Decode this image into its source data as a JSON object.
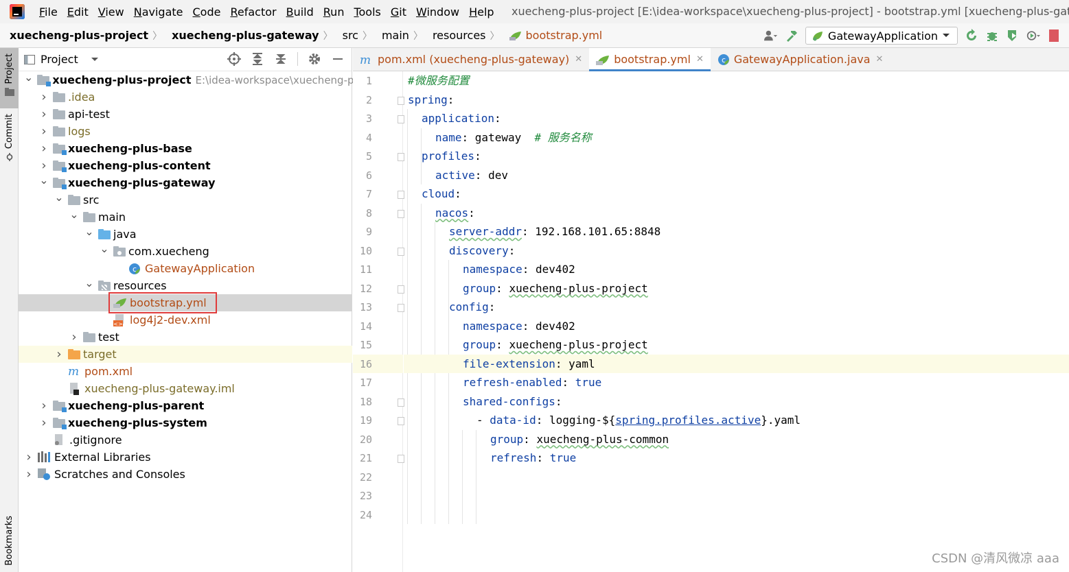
{
  "menubar": {
    "items": [
      "File",
      "Edit",
      "View",
      "Navigate",
      "Code",
      "Refactor",
      "Build",
      "Run",
      "Tools",
      "Git",
      "Window",
      "Help"
    ],
    "window_title": "xuecheng-plus-project [E:\\idea-workspace\\xuecheng-plus-project] - bootstrap.yml [xuecheng-plus-gateway]"
  },
  "breadcrumb": {
    "items": [
      "xuecheng-plus-project",
      "xuecheng-plus-gateway",
      "src",
      "main",
      "resources",
      "bootstrap.yml"
    ]
  },
  "toolbar": {
    "run_config": "GatewayApplication",
    "icons": [
      "user-icon",
      "build-hammer-icon",
      "rerun-icon",
      "debug-icon",
      "coverage-icon",
      "profile-icon",
      "more-icon",
      "stop-icon"
    ]
  },
  "left_stripe": {
    "tabs": [
      "Project",
      "Commit",
      "Bookmarks"
    ]
  },
  "project_panel": {
    "title": "Project",
    "tree": [
      {
        "label": "xuecheng-plus-project",
        "extra": "E:\\idea-workspace\\xuecheng-plus-",
        "indent": 0,
        "arrow": "v",
        "icon": "module",
        "style": "bold"
      },
      {
        "label": ".idea",
        "indent": 1,
        "arrow": ">",
        "icon": "folder",
        "style": "olive"
      },
      {
        "label": "api-test",
        "indent": 1,
        "arrow": ">",
        "icon": "folder",
        "style": "normal"
      },
      {
        "label": "logs",
        "indent": 1,
        "arrow": ">",
        "icon": "folder",
        "style": "olive"
      },
      {
        "label": "xuecheng-plus-base",
        "indent": 1,
        "arrow": ">",
        "icon": "module",
        "style": "bold"
      },
      {
        "label": "xuecheng-plus-content",
        "indent": 1,
        "arrow": ">",
        "icon": "module",
        "style": "bold"
      },
      {
        "label": "xuecheng-plus-gateway",
        "indent": 1,
        "arrow": "v",
        "icon": "module",
        "style": "bold"
      },
      {
        "label": "src",
        "indent": 2,
        "arrow": "v",
        "icon": "folder",
        "style": "normal"
      },
      {
        "label": "main",
        "indent": 3,
        "arrow": "v",
        "icon": "folder",
        "style": "normal"
      },
      {
        "label": "java",
        "indent": 4,
        "arrow": "v",
        "icon": "blue",
        "style": "normal"
      },
      {
        "label": "com.xuecheng",
        "indent": 5,
        "arrow": "v",
        "icon": "pkg",
        "style": "normal"
      },
      {
        "label": "GatewayApplication",
        "indent": 6,
        "arrow": "",
        "icon": "spring-class",
        "style": "brown"
      },
      {
        "label": "resources",
        "indent": 4,
        "arrow": "v",
        "icon": "res",
        "style": "normal"
      },
      {
        "label": "bootstrap.yml",
        "indent": 5,
        "arrow": "",
        "icon": "yml",
        "style": "brown",
        "selected": true
      },
      {
        "label": "log4j2-dev.xml",
        "indent": 5,
        "arrow": "",
        "icon": "xml",
        "style": "brown"
      },
      {
        "label": "test",
        "indent": 3,
        "arrow": ">",
        "icon": "folder",
        "style": "normal"
      },
      {
        "label": "target",
        "indent": 2,
        "arrow": ">",
        "icon": "orange",
        "style": "olive",
        "target": true
      },
      {
        "label": "pom.xml",
        "indent": 2,
        "arrow": "",
        "icon": "maven",
        "style": "brown"
      },
      {
        "label": "xuecheng-plus-gateway.iml",
        "indent": 2,
        "arrow": "",
        "icon": "iml",
        "style": "olive"
      },
      {
        "label": "xuecheng-plus-parent",
        "indent": 1,
        "arrow": ">",
        "icon": "module",
        "style": "bold"
      },
      {
        "label": "xuecheng-plus-system",
        "indent": 1,
        "arrow": ">",
        "icon": "module",
        "style": "bold"
      },
      {
        "label": ".gitignore",
        "indent": 1,
        "arrow": "",
        "icon": "gitignore",
        "style": "normal"
      },
      {
        "label": "External Libraries",
        "indent": 0,
        "arrow": ">",
        "icon": "libs",
        "style": "normal"
      },
      {
        "label": "Scratches and Consoles",
        "indent": 0,
        "arrow": ">",
        "icon": "scratch",
        "style": "normal"
      }
    ]
  },
  "editor": {
    "tabs": [
      {
        "label": "pom.xml (xuecheng-plus-gateway)",
        "icon": "maven-icon",
        "active": false
      },
      {
        "label": "bootstrap.yml",
        "icon": "yml-icon",
        "active": true
      },
      {
        "label": "GatewayApplication.java",
        "icon": "spring-class-icon",
        "active": false
      }
    ],
    "line_count": 24,
    "current_line": 16,
    "lines": [
      {
        "indent": 0,
        "parts": [
          [
            "c",
            "#微服务配置"
          ]
        ]
      },
      {
        "indent": 0,
        "parts": [
          [
            "k",
            "spring"
          ],
          [
            "v",
            ":"
          ]
        ]
      },
      {
        "indent": 1,
        "parts": [
          [
            "k",
            "application"
          ],
          [
            "v",
            ":"
          ]
        ]
      },
      {
        "indent": 2,
        "parts": [
          [
            "k",
            "name"
          ],
          [
            "v",
            ": gateway  "
          ],
          [
            "c",
            "# 服务名称"
          ]
        ]
      },
      {
        "indent": 1,
        "parts": [
          [
            "k",
            "profiles"
          ],
          [
            "v",
            ":"
          ]
        ]
      },
      {
        "indent": 2,
        "parts": [
          [
            "k",
            "active"
          ],
          [
            "v",
            ": dev"
          ]
        ]
      },
      {
        "indent": 1,
        "parts": [
          [
            "k",
            "cloud"
          ],
          [
            "v",
            ":"
          ]
        ]
      },
      {
        "indent": 2,
        "parts": [
          [
            "k sq",
            "nacos"
          ],
          [
            "v",
            ":"
          ]
        ]
      },
      {
        "indent": 3,
        "parts": [
          [
            "k sq",
            "server-addr"
          ],
          [
            "v",
            ": 192.168.101.65:8848"
          ]
        ]
      },
      {
        "indent": 3,
        "parts": [
          [
            "k",
            "discovery"
          ],
          [
            "v",
            ":"
          ]
        ]
      },
      {
        "indent": 4,
        "parts": [
          [
            "k",
            "namespace"
          ],
          [
            "v",
            ": dev402"
          ]
        ]
      },
      {
        "indent": 4,
        "parts": [
          [
            "k",
            "group"
          ],
          [
            "v",
            ": "
          ],
          [
            "v sq",
            "xuecheng-plus-project"
          ]
        ]
      },
      {
        "indent": 3,
        "parts": [
          [
            "k",
            "config"
          ],
          [
            "v",
            ":"
          ]
        ]
      },
      {
        "indent": 4,
        "parts": [
          [
            "k",
            "namespace"
          ],
          [
            "v",
            ": dev402"
          ]
        ]
      },
      {
        "indent": 4,
        "parts": [
          [
            "k",
            "group"
          ],
          [
            "v",
            ": "
          ],
          [
            "v sq",
            "xuecheng-plus-project"
          ]
        ]
      },
      {
        "indent": 4,
        "parts": [
          [
            "k",
            "file-extension"
          ],
          [
            "v",
            ": yaml"
          ]
        ]
      },
      {
        "indent": 4,
        "parts": [
          [
            "k",
            "refresh-enabled"
          ],
          [
            "v",
            ": "
          ],
          [
            "tr",
            "true"
          ]
        ]
      },
      {
        "indent": 4,
        "parts": [
          [
            "k",
            "shared-configs"
          ],
          [
            "v",
            ":"
          ]
        ]
      },
      {
        "indent": 5,
        "parts": [
          [
            "v",
            "- "
          ],
          [
            "k",
            "data-id"
          ],
          [
            "v",
            ": logging-${"
          ],
          [
            "u",
            "spring.profiles.active"
          ],
          [
            "v",
            "}.yaml"
          ]
        ]
      },
      {
        "indent": 6,
        "parts": [
          [
            "k",
            "group"
          ],
          [
            "v",
            ": "
          ],
          [
            "v sq",
            "xuecheng-plus-common"
          ]
        ]
      },
      {
        "indent": 6,
        "parts": [
          [
            "k",
            "refresh"
          ],
          [
            "v",
            ": "
          ],
          [
            "tr",
            "true"
          ]
        ]
      },
      {
        "indent": 0,
        "parts": []
      },
      {
        "indent": 0,
        "parts": []
      },
      {
        "indent": 0,
        "parts": []
      }
    ]
  },
  "watermark": "CSDN @清风微凉 aaa"
}
